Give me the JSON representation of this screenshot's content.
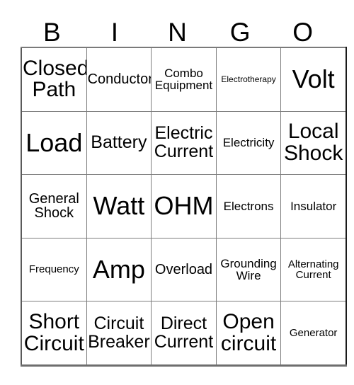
{
  "card": {
    "type": "bingo-card",
    "header_letters": [
      "B",
      "I",
      "N",
      "G",
      "O"
    ],
    "columns": 5,
    "rows": 5,
    "text_color": "#000000",
    "background_color": "#ffffff",
    "gridline_color": "#7d7d7d",
    "cells": [
      [
        {
          "text": "Closed\nPath",
          "size": "fs-xl"
        },
        {
          "text": "Conductor",
          "size": "fs-m"
        },
        {
          "text": "Combo\nEquipment",
          "size": "fs-s"
        },
        {
          "text": "Electrotherapy",
          "size": "fs-xxs"
        },
        {
          "text": "Volt",
          "size": "fs-xxl"
        }
      ],
      [
        {
          "text": "Load",
          "size": "fs-xxl"
        },
        {
          "text": "Battery",
          "size": "fs-l"
        },
        {
          "text": "Electric\nCurrent",
          "size": "fs-l"
        },
        {
          "text": "Electricity",
          "size": "fs-s"
        },
        {
          "text": "Local\nShock",
          "size": "fs-xl"
        }
      ],
      [
        {
          "text": "General\nShock",
          "size": "fs-m"
        },
        {
          "text": "Watt",
          "size": "fs-xxl"
        },
        {
          "text": "OHM",
          "size": "fs-xxl"
        },
        {
          "text": "Electrons",
          "size": "fs-s"
        },
        {
          "text": "Insulator",
          "size": "fs-s"
        }
      ],
      [
        {
          "text": "Frequency",
          "size": "fs-xs"
        },
        {
          "text": "Amp",
          "size": "fs-xxl"
        },
        {
          "text": "Overload",
          "size": "fs-m"
        },
        {
          "text": "Grounding\nWire",
          "size": "fs-s"
        },
        {
          "text": "Alternating\nCurrent",
          "size": "fs-xs"
        }
      ],
      [
        {
          "text": "Short\nCircuit",
          "size": "fs-xl"
        },
        {
          "text": "Circuit\nBreaker",
          "size": "fs-l"
        },
        {
          "text": "Direct\nCurrent",
          "size": "fs-l"
        },
        {
          "text": "Open\ncircuit",
          "size": "fs-xl"
        },
        {
          "text": "Generator",
          "size": "fs-xs"
        }
      ]
    ]
  }
}
